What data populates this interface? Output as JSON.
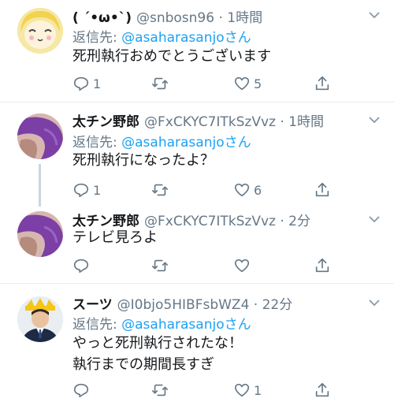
{
  "tweets": [
    {
      "name": "( ´•ω•`)",
      "handle_time": "@snbosn96 · 1時間",
      "reply_prefix": "返信先: ",
      "reply_mention": "@asaharasanjoさん",
      "text_lines": [
        "死刑執行おめでとうございます"
      ],
      "reply_count": "1",
      "retweet_count": "",
      "like_count": "5"
    },
    {
      "name": "太チン野郎",
      "handle_time": "@FxCKYC7ITkSzVvz · 1時間",
      "reply_prefix": "返信先: ",
      "reply_mention": "@asaharasanjoさん",
      "text_lines": [
        "死刑執行になったよ？"
      ],
      "reply_count": "1",
      "retweet_count": "",
      "like_count": "6"
    },
    {
      "name": "太チン野郎",
      "handle_time": "@FxCKYC7ITkSzVvz · 2分",
      "text_lines": [
        "テレビ見ろよ"
      ],
      "reply_count": "",
      "retweet_count": "",
      "like_count": ""
    },
    {
      "name": "スーツ",
      "handle_time": "@I0bjo5HIBFsbWZ4 · 22分",
      "reply_prefix": "返信先: ",
      "reply_mention": "@asaharasanjoさん",
      "text_lines": [
        "やっと死刑執行されたな！",
        "執行までの期間長すぎ"
      ],
      "reply_count": "",
      "retweet_count": "",
      "like_count": "1"
    }
  ],
  "colors": {
    "link": "#1da1f2",
    "secondary": "#657786",
    "divider": "#e6ecf0"
  },
  "icons": [
    "reply-icon",
    "retweet-icon",
    "like-icon",
    "share-icon",
    "chevron-down-icon"
  ]
}
